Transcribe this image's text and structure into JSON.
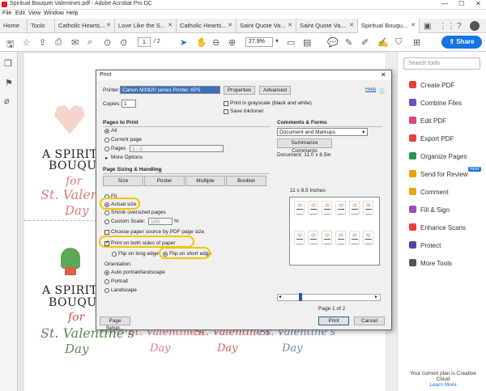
{
  "window": {
    "title": "Spiritual Bouquet Valentines.pdf - Adobe Acrobat Pro DC",
    "minimize": "—",
    "maximize": "☐",
    "close": "✕"
  },
  "menu": [
    "File",
    "Edit",
    "View",
    "Window",
    "Help"
  ],
  "tabs": [
    {
      "label": "Home"
    },
    {
      "label": "Tools"
    },
    {
      "label": "Catholic Hearts..."
    },
    {
      "label": "Love Like the S..."
    },
    {
      "label": "Catholic Hearts..."
    },
    {
      "label": "Saint Quote Va..."
    },
    {
      "label": "Saint Quote Va..."
    },
    {
      "label": "Spiritual Bouqu..."
    }
  ],
  "toolbar": {
    "page_current": "1",
    "page_total": "/ 2",
    "zoom": "27.9%",
    "share_label": "Share"
  },
  "page_content": {
    "heading_1": "A SPIRITUAL",
    "heading_2": "BOUQUET",
    "for": "for",
    "st": "St. Valentine's",
    "day": "Day"
  },
  "right_panel": {
    "search_placeholder": "Search tools",
    "tools": [
      {
        "label": "Create PDF",
        "color": "#e8413a"
      },
      {
        "label": "Combine Files",
        "color": "#6b4fbb"
      },
      {
        "label": "Edit PDF",
        "color": "#e04580"
      },
      {
        "label": "Export PDF",
        "color": "#e8413a"
      },
      {
        "label": "Organize Pages",
        "color": "#2a9a4a"
      },
      {
        "label": "Send for Review",
        "color": "#e8a400",
        "badge": "NEW"
      },
      {
        "label": "Comment",
        "color": "#e8a400"
      },
      {
        "label": "Fill & Sign",
        "color": "#9a4dbb"
      },
      {
        "label": "Enhance Scans",
        "color": "#e8413a"
      },
      {
        "label": "Protect",
        "color": "#4a4aab"
      },
      {
        "label": "More Tools",
        "color": "#555555"
      }
    ],
    "plan_text": "Your current plan is Creative Cloud",
    "learn_more": "Learn More"
  },
  "print": {
    "title": "Print",
    "close": "✕",
    "printer_label": "Printer:",
    "printer_value": "Canon MX920 series Printer XPS",
    "properties": "Properties",
    "advanced": "Advanced",
    "help": "Help",
    "copies_label": "Copies:",
    "copies_value": "1",
    "grayscale": "Print in grayscale (black and white)",
    "save_ink": "Save ink/toner",
    "pages_to_print": "Pages to Print",
    "all": "All",
    "current_page": "Current page",
    "pages": "Pages",
    "pages_value": "1 - 2",
    "more_options": "More Options",
    "sizing_title": "Page Sizing & Handling",
    "size_btn": "Size",
    "poster_btn": "Poster",
    "multiple_btn": "Multiple",
    "booklet_btn": "Booklet",
    "fit": "Fit",
    "actual_size": "Actual size",
    "shrink": "Shrink oversized pages",
    "custom_scale": "Custom Scale:",
    "custom_value": "100",
    "percent": "%",
    "paper_source": "Choose paper source by PDF page size",
    "both_sides": "Print on both sides of paper",
    "flip_long": "Flip on long edge",
    "flip_short": "Flip on short edge",
    "orientation": "Orientation:",
    "auto": "Auto portrait/landscape",
    "portrait": "Portrait",
    "landscape": "Landscape",
    "comments_title": "Comments & Forms",
    "comments_value": "Document and Markups",
    "summarize": "Summarize Comments",
    "doc_size": "Document: 11.0 x 8.5in",
    "preview_size": "11 x 8.5 Inches",
    "page_of": "Page 1 of 2",
    "page_setup": "Page Setup...",
    "print_btn": "Print",
    "cancel_btn": "Cancel"
  }
}
